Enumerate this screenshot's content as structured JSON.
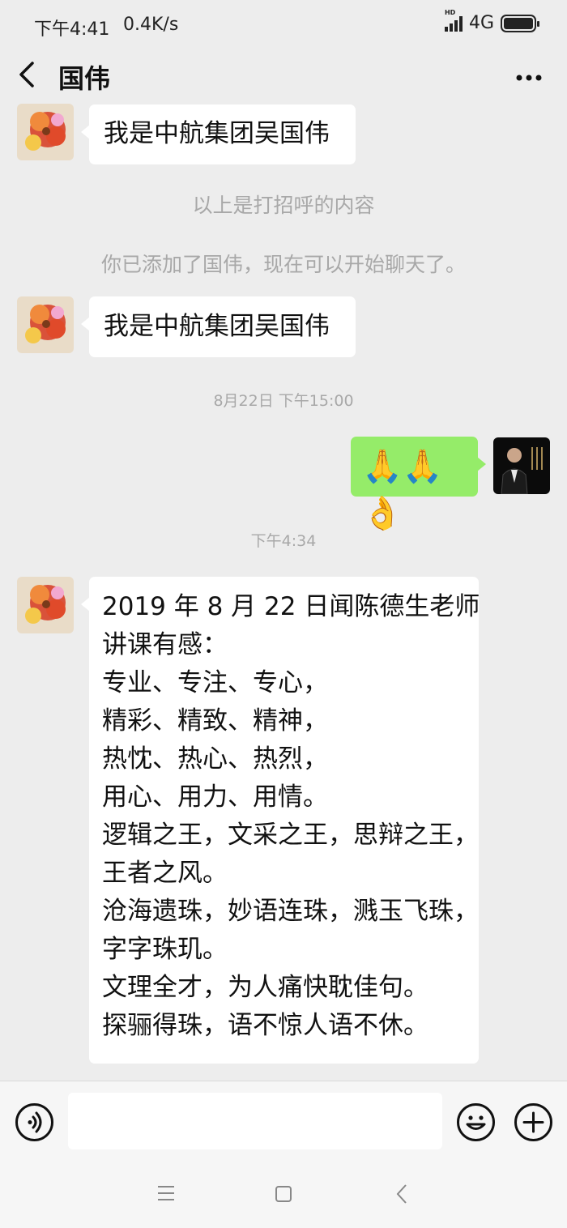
{
  "status_bar": {
    "time": "下午4:41",
    "speed": "0.4K/s",
    "network": "4G"
  },
  "header": {
    "title": "国伟"
  },
  "messages": {
    "m1": "我是中航集团吴国伟",
    "sys1": "以上是打招呼的内容",
    "sys2": "你已添加了国伟，现在可以开始聊天了。",
    "m2": "我是中航集团吴国伟",
    "ts1": "8月22日 下午15:00",
    "m3_emoji": "🙏🙏👌",
    "ts2": "下午4:34",
    "m4_lines": [
      "2019 年 8 月 22 日闻陈德生老师",
      "讲课有感：",
      "专业、专注、专心，",
      "精彩、精致、精神，",
      "热忱、热心、热烈，",
      "用心、用力、用情。",
      "逻辑之王，文采之王，思辩之王，",
      "王者之风。",
      "沧海遗珠，妙语连珠，溅玉飞珠，",
      "字字珠玑。",
      "文理全才，为人痛快耽佳句。",
      "探骊得珠，语不惊人语不休。"
    ]
  },
  "icons": {
    "back": "back-arrow-icon",
    "more": "more-dots-icon",
    "voice": "voice-icon",
    "emoji": "emoji-icon",
    "plus": "plus-icon",
    "menu": "menu-icon",
    "home": "home-icon",
    "nav_back": "nav-back-icon"
  },
  "colors": {
    "background": "#ededed",
    "sent_bubble": "#95ec69",
    "received_bubble": "#ffffff",
    "system_text": "#a8a8a8"
  }
}
